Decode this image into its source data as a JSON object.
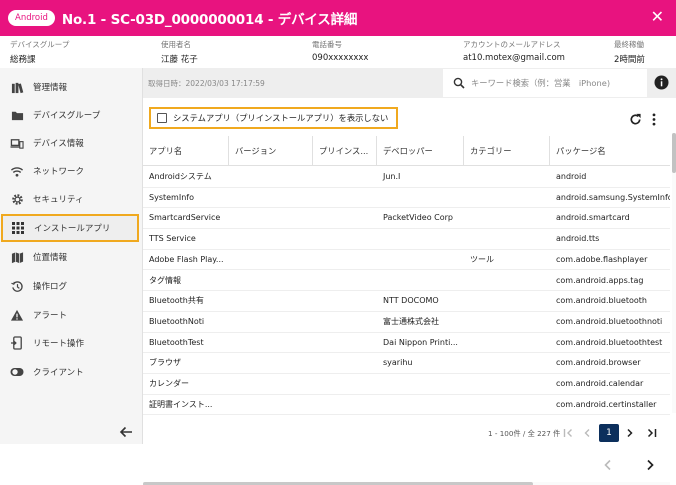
{
  "header": {
    "os_badge": "Android",
    "title": "No.1 - SC-03D_0000000014 - デバイス詳細"
  },
  "info": [
    {
      "label": "デバイスグループ",
      "value": "総務課"
    },
    {
      "label": "使用者名",
      "value": "江藤 花子"
    },
    {
      "label": "電話番号",
      "value": "090xxxxxxxx"
    },
    {
      "label": "アカウントのメールアドレス",
      "value": "at10.motex@gmail.com"
    },
    {
      "label": "最終稼働",
      "value": "2時間前"
    }
  ],
  "sidebar": {
    "items": [
      {
        "label": "管理情報",
        "icon": "books-icon"
      },
      {
        "label": "デバイスグループ",
        "icon": "folder-icon"
      },
      {
        "label": "デバイス情報",
        "icon": "devices-icon"
      },
      {
        "label": "ネットワーク",
        "icon": "wifi-icon"
      },
      {
        "label": "セキュリティ",
        "icon": "gear-icon"
      },
      {
        "label": "インストールアプリ",
        "icon": "apps-grid-icon",
        "active": true
      },
      {
        "label": "位置情報",
        "icon": "map-icon"
      },
      {
        "label": "操作ログ",
        "icon": "history-icon"
      },
      {
        "label": "アラート",
        "icon": "warning-icon"
      },
      {
        "label": "リモート操作",
        "icon": "phone-remote-icon"
      },
      {
        "label": "クライアント",
        "icon": "toggle-icon"
      }
    ]
  },
  "toolbar": {
    "fetch_date": "取得日時：2022/03/03 17:17:59",
    "search_placeholder": "キーワード検索（例：営業　iPhone)",
    "filter_label": "システムアプリ（プリインストールアプリ）を表示しない",
    "filter_checked": false
  },
  "table": {
    "columns": [
      "アプリ名",
      "バージョン",
      "プリインス...",
      "デベロッパー",
      "カテゴリー",
      "パッケージ名"
    ],
    "rows": [
      [
        "Androidシステム",
        "",
        "",
        "Jun.I",
        "",
        "android"
      ],
      [
        "SystemInfo",
        "",
        "",
        "",
        "",
        "android.samsung.SystemInfo"
      ],
      [
        "SmartcardService",
        "",
        "",
        "PacketVideo Corp",
        "",
        "android.smartcard"
      ],
      [
        "TTS Service",
        "",
        "",
        "",
        "",
        "android.tts"
      ],
      [
        "Adobe Flash Play...",
        "",
        "",
        "",
        "ツール",
        "com.adobe.flashplayer"
      ],
      [
        "タグ情報",
        "",
        "",
        "",
        "",
        "com.android.apps.tag"
      ],
      [
        "Bluetooth共有",
        "",
        "",
        "NTT DOCOMO",
        "",
        "com.android.bluetooth"
      ],
      [
        "BluetoothNoti",
        "",
        "",
        "富士通株式会社",
        "",
        "com.android.bluetoothnoti"
      ],
      [
        "BluetoothTest",
        "",
        "",
        "Dai Nippon Printi...",
        "",
        "com.android.bluetoothtest"
      ],
      [
        "ブラウザ",
        "",
        "",
        "syarihu",
        "",
        "com.android.browser"
      ],
      [
        "カレンダー",
        "",
        "",
        "",
        "",
        "com.android.calendar"
      ],
      [
        "証明書インスト...",
        "",
        "",
        "",
        "",
        "com.android.certinstaller"
      ]
    ]
  },
  "pagination": {
    "summary": "1 - 100件 / 全 227 件",
    "current_page": "1"
  },
  "colors": {
    "brand": "#e8137f",
    "highlight": "#f0a91f",
    "page_current": "#0c2f5c"
  }
}
